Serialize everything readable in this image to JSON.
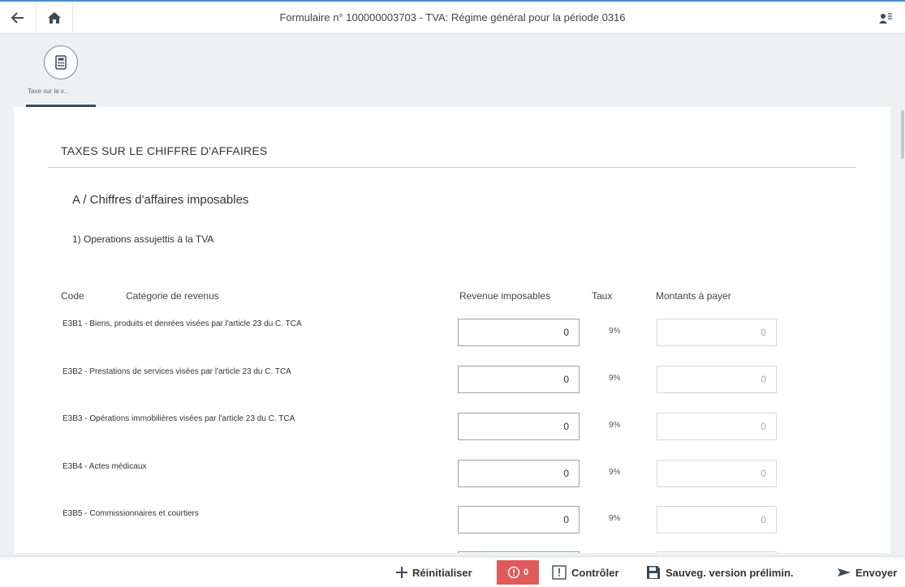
{
  "shell": {
    "title": "Formulaire n° 100000003703 - TVA: Régime général pour la période 0316"
  },
  "icon_tab": {
    "label": "Taxe sur la v..."
  },
  "form": {
    "section_title": "TAXES SUR LE CHIFFRE D'AFFAIRES",
    "sub_title": "A / Chiffres d'affaires imposables",
    "sub_sub_title": "1) Operations assujettis à la TVA",
    "columns": {
      "code": "Code",
      "category": "Catégorie de revenus",
      "revenue": "Revenue imposables",
      "rate": "Taux",
      "amount": "Montants à payer"
    },
    "rows": [
      {
        "label": "E3B1 - Biens, produits et denrées visées par l'article 23 du C. TCA",
        "revenue": "0",
        "rate": "9%",
        "amount": "0"
      },
      {
        "label": "E3B2 - Prestations de services visées par l'article 23 du C. TCA",
        "revenue": "0",
        "rate": "9%",
        "amount": "0"
      },
      {
        "label": "E3B3 - Opérations immobilières visées par l'article 23 du C. TCA",
        "revenue": "0",
        "rate": "9%",
        "amount": "0"
      },
      {
        "label": "E3B4 - Actes médicaux",
        "revenue": "0",
        "rate": "9%",
        "amount": "0"
      },
      {
        "label": "E3B5 - Commissionnaires et courtiers",
        "revenue": "0",
        "rate": "9%",
        "amount": "0"
      }
    ]
  },
  "footer": {
    "reset_label": "Réinitialiser",
    "error_count": "0",
    "check_label": "Contrôler",
    "save_label": "Sauveg. version prélimin.",
    "send_label": "Envoyer"
  },
  "colors": {
    "accent": "#4a90c8",
    "error": "#e05a5a",
    "background": "#eef0f2"
  },
  "icons": [
    "back-arrow-icon",
    "home-icon",
    "user-menu-icon",
    "calculator-icon",
    "plus-icon",
    "error-icon",
    "warning-icon",
    "save-icon",
    "send-icon"
  ]
}
